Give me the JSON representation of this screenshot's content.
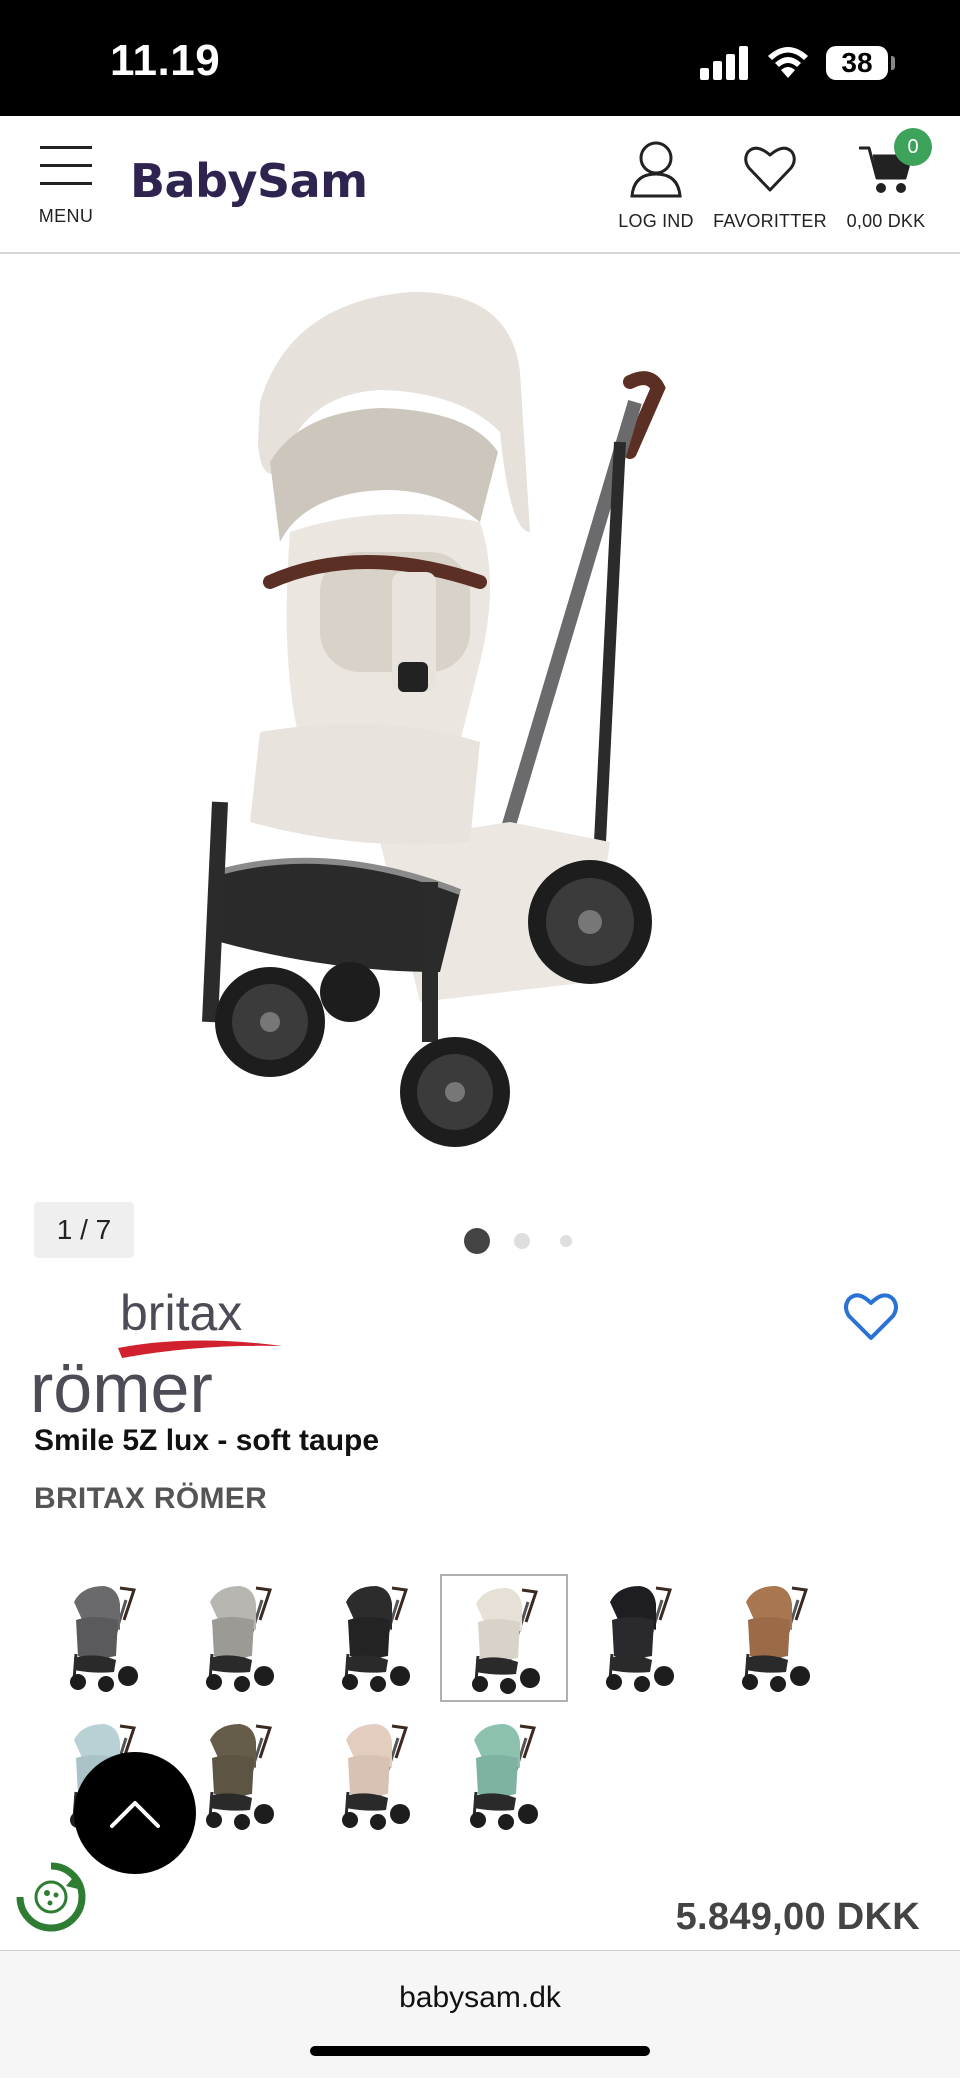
{
  "status_bar": {
    "time": "11.19",
    "battery": "38",
    "icons": [
      "cellular-signal-icon",
      "wifi-icon",
      "battery-icon"
    ]
  },
  "header": {
    "logo": "BabySam",
    "menu_label": "MENU",
    "login_label": "LOG IND",
    "favorites_label": "FAVORITTER",
    "cart_label": "0,00 DKK",
    "cart_count": "0",
    "icons": [
      "menu-icon",
      "user-icon",
      "heart-icon",
      "cart-icon"
    ],
    "accent_color": "#3ea35a",
    "logo_color": "#2f2350"
  },
  "gallery": {
    "counter": "1 / 7",
    "current_slide": 1,
    "dots": 3
  },
  "product": {
    "brand_logo_text": [
      "britax",
      "römer"
    ],
    "title": "Smile 5Z lux - soft taupe",
    "brand": "BRITAX RÖMER",
    "price": "5.849,00 DKK",
    "favorite_icon": "heart-outline-icon",
    "favorite_color": "#2a72d4"
  },
  "variants": {
    "selected_index": 3,
    "colors": [
      {
        "body": "#5a5a5c",
        "hood": "#6a6a6c"
      },
      {
        "body": "#9c9a94",
        "hood": "#b8b6b0"
      },
      {
        "body": "#232323",
        "hood": "#2c2c2c"
      },
      {
        "body": "#d9d2c8",
        "hood": "#e6e0d6"
      },
      {
        "body": "#2a2a2e",
        "hood": "#1e1e22"
      },
      {
        "body": "#9b6a47",
        "hood": "#a8764f"
      },
      {
        "body": "#a9c3c6",
        "hood": "#b8d1d4"
      },
      {
        "body": "#5d5544",
        "hood": "#655c4a"
      },
      {
        "body": "#d8c2b4",
        "hood": "#e2cdbf"
      },
      {
        "body": "#7db3a0",
        "hood": "#8cc2ad"
      }
    ]
  },
  "browser": {
    "url": "babysam.dk"
  }
}
